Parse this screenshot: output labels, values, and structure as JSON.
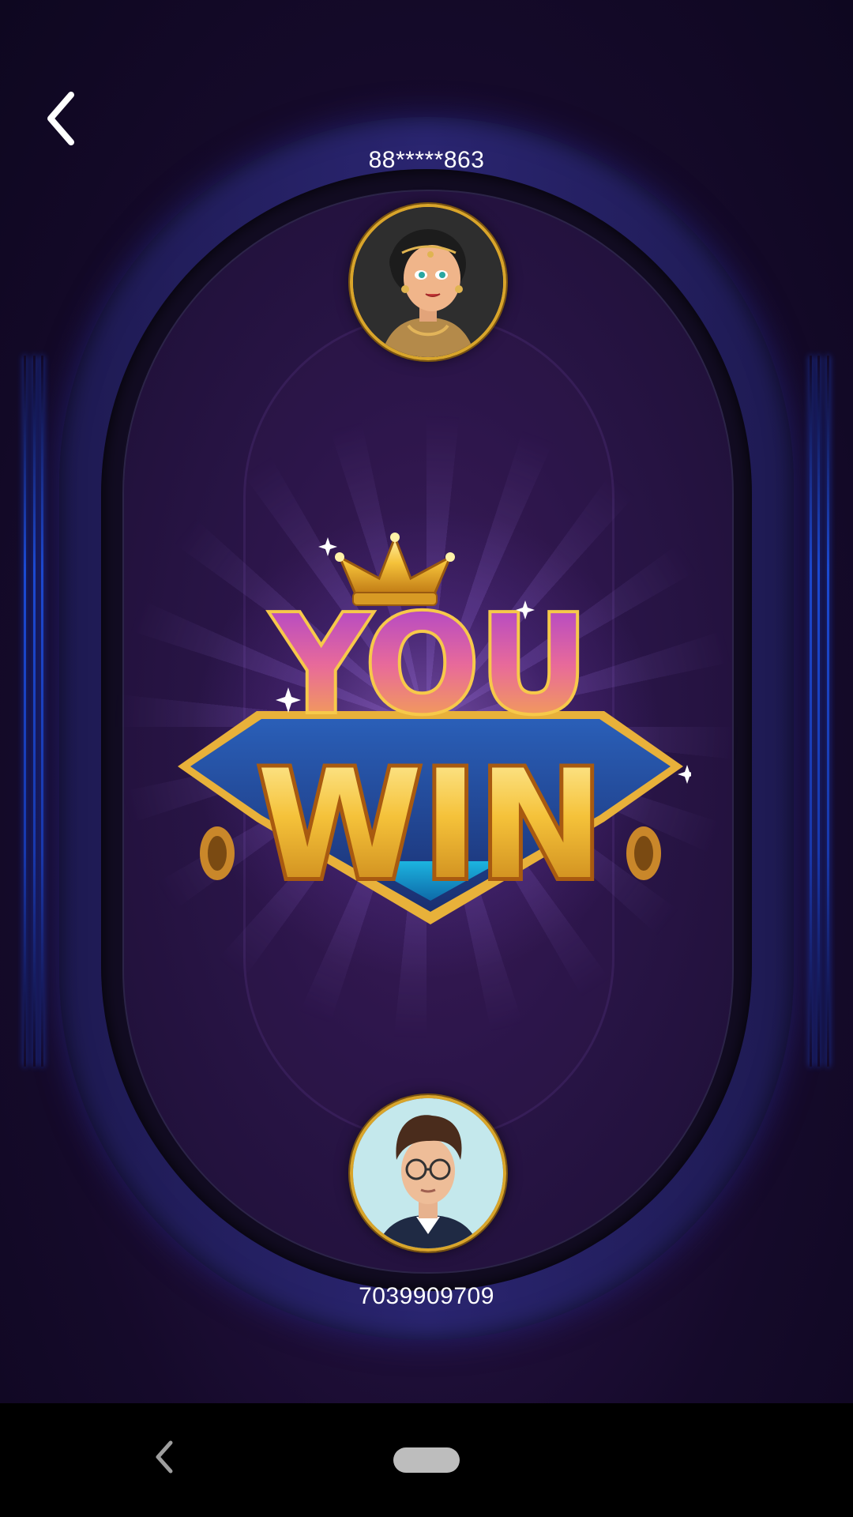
{
  "players": {
    "opponent": {
      "name": "88*****863",
      "avatar_icon": "female-character-avatar"
    },
    "self": {
      "name": "7039909709",
      "avatar_icon": "male-character-avatar"
    }
  },
  "result": {
    "line1": "YOU",
    "line2": "WIN"
  },
  "icons": {
    "back": "chevron-left-icon",
    "crown": "crown-icon",
    "nav_back": "nav-back-icon",
    "nav_home": "nav-home-pill"
  },
  "colors": {
    "gold": "#f5c23a",
    "purple": "#b34ad6",
    "felt": "#2a1548",
    "rail": "#2a2570"
  }
}
